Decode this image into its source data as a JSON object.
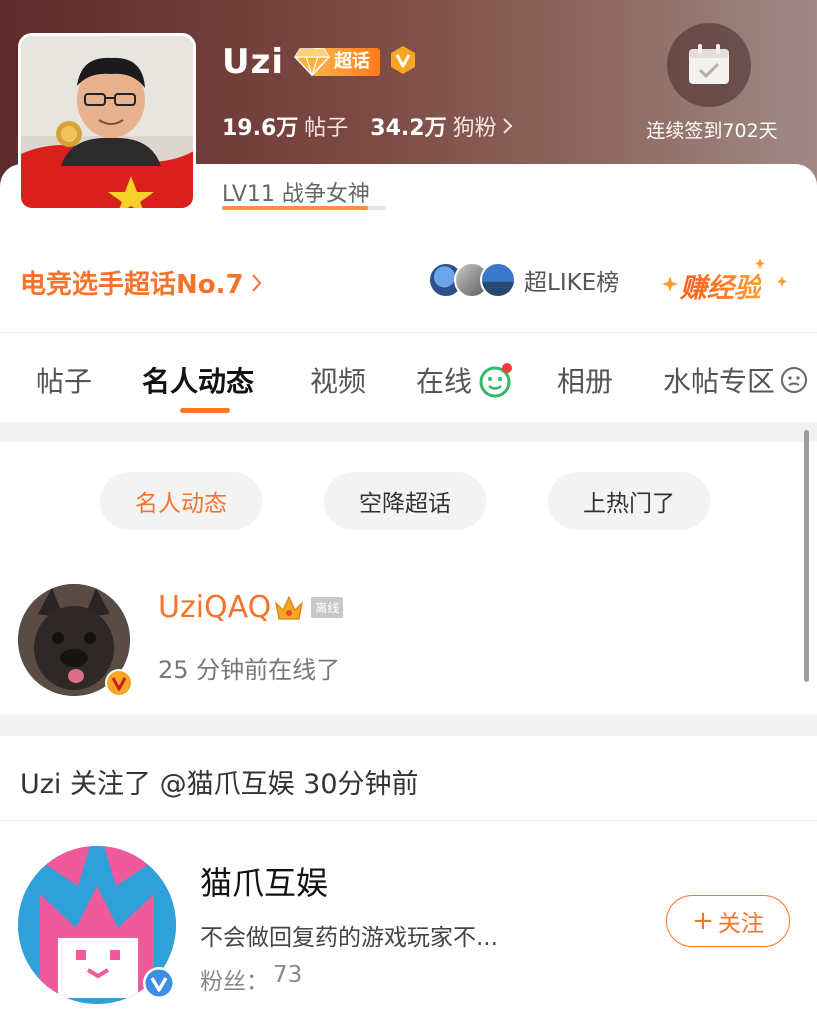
{
  "header": {
    "topic_name": "Uzi",
    "super_topic_badge": "超话",
    "posts_count": "19.6万",
    "posts_label": "帖子",
    "fans_count": "34.2万",
    "fans_label": "狗粉",
    "checkin_text": "连续签到702天",
    "level_text": "LV11 战争女神",
    "level_progress": 0.89
  },
  "rank": {
    "category_link": "电竞选手超话No.7",
    "like_board_label": "超LIKE榜",
    "earn_exp_label": "赚经验"
  },
  "tabs": [
    {
      "label": "帖子",
      "active": false
    },
    {
      "label": "名人动态",
      "active": true
    },
    {
      "label": "视频",
      "active": false
    },
    {
      "label": "在线",
      "active": false
    },
    {
      "label": "相册",
      "active": false
    },
    {
      "label": "水帖专区",
      "active": false
    }
  ],
  "filters": [
    {
      "label": "名人动态",
      "active": true
    },
    {
      "label": "空降超话",
      "active": false
    },
    {
      "label": "上热门了",
      "active": false
    }
  ],
  "online_user": {
    "name": "UziQAQ",
    "offline_tag": "离线",
    "status": "25 分钟前在线了"
  },
  "follow_activity": {
    "text": "Uzi 关注了 @猫爪互娱 30分钟前",
    "account": {
      "name": "猫爪互娱",
      "description": "不会做回复药的游戏玩家不...",
      "fans_label": "粉丝：",
      "fans_count": "73",
      "follow_label": "关注",
      "follow_plus": "+"
    }
  },
  "colors": {
    "accent": "#f6732c",
    "header_bg": "#6e3a36",
    "chip_bg": "#f3f3f3"
  }
}
